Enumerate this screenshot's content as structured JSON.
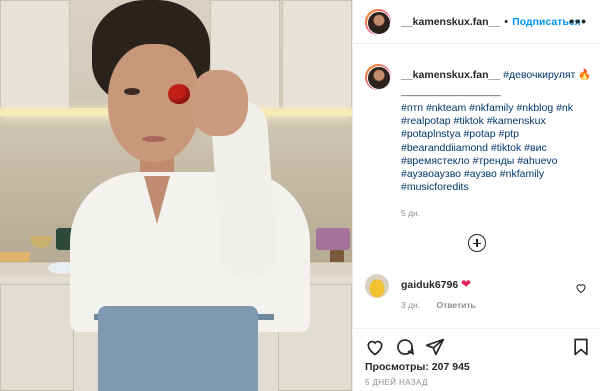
{
  "post": {
    "author": "__kamenskux.fan__",
    "follow_label": "Подписаться",
    "more_label": "•••"
  },
  "caption": {
    "username": "__kamenskux.fan__",
    "first_tag": "#девочкирулят",
    "emoji": "🔥",
    "underline": "______________________",
    "hashtags": "#птп #nkteam #nkfamily #nkblog #nk #realpotap #tiktok #kamenskux #potaplnstya #potap #ptp #bearanddiiamond #tiktok #вис #времястекло #тренды #ahuevo #аузвоаузво #аузво #nkfamily #musicforedits",
    "age": "5 дн."
  },
  "comments": [
    {
      "username": "gaiduk6796",
      "emoji": "❤",
      "time": "3 дн.",
      "reply_label": "Ответить"
    }
  ],
  "footer": {
    "views": "Просмотры: 207 945",
    "posted": "5 ДНЕЙ НАЗАД"
  },
  "icons": {
    "more": "more-horizontal-icon",
    "add": "plus-circle-icon",
    "like": "heart-outline-icon",
    "comment": "comment-icon",
    "share": "paper-plane-icon",
    "save": "bookmark-icon"
  }
}
